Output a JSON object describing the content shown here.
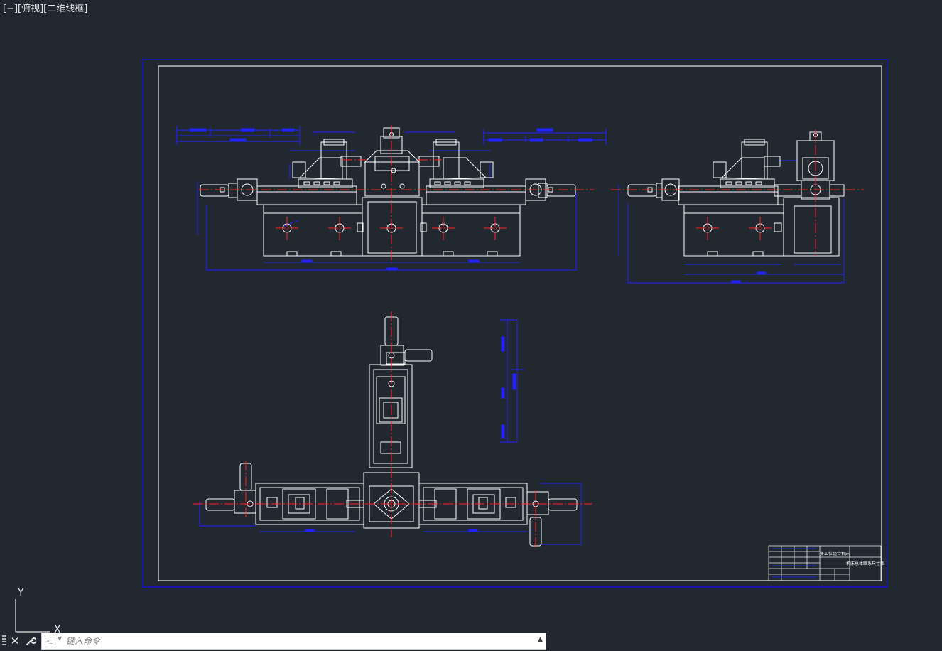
{
  "viewport": {
    "label": "[−][俯视][二维线框]"
  },
  "ucs": {
    "y_label": "Y",
    "x_label": "X"
  },
  "colors": {
    "background": "#212830",
    "drawing_line": "#ffffff",
    "dimension_line": "#1a1aff",
    "center_line": "#ff1a1a",
    "sheet_border": "#1010b0"
  },
  "title_block": {
    "project_title": "多工位组合机床",
    "drawing_name": "机床总体联系尺寸图"
  },
  "command_line": {
    "placeholder": "键入命令",
    "close_icon": "close-icon",
    "customize_icon": "wrench-icon"
  }
}
